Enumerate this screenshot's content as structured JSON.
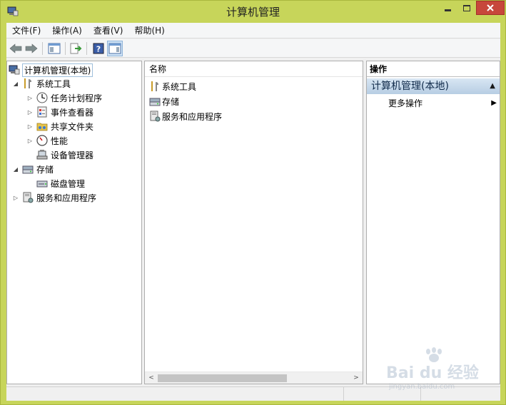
{
  "window": {
    "title": "计算机管理"
  },
  "menubar": {
    "items": [
      "文件(F)",
      "操作(A)",
      "查看(V)",
      "帮助(H)"
    ]
  },
  "toolbar": {
    "icons": [
      "back-arrow-icon",
      "forward-arrow-icon",
      "show-hide-console-tree-icon",
      "export-list-icon",
      "help-icon",
      "show-hide-action-pane-icon"
    ]
  },
  "tree": {
    "root": "计算机管理(本地)",
    "system_tools": "系统工具",
    "task_scheduler": "任务计划程序",
    "event_viewer": "事件查看器",
    "shared_folders": "共享文件夹",
    "performance": "性能",
    "device_manager": "设备管理器",
    "storage": "存储",
    "disk_management": "磁盘管理",
    "services_apps": "服务和应用程序"
  },
  "list": {
    "header": "名称",
    "rows": [
      "系统工具",
      "存储",
      "服务和应用程序"
    ]
  },
  "actions": {
    "header": "操作",
    "section": "计算机管理(本地)",
    "more": "更多操作"
  },
  "watermark": {
    "brand": "Bai du 经验",
    "url": "jingyan.baidu.com"
  }
}
